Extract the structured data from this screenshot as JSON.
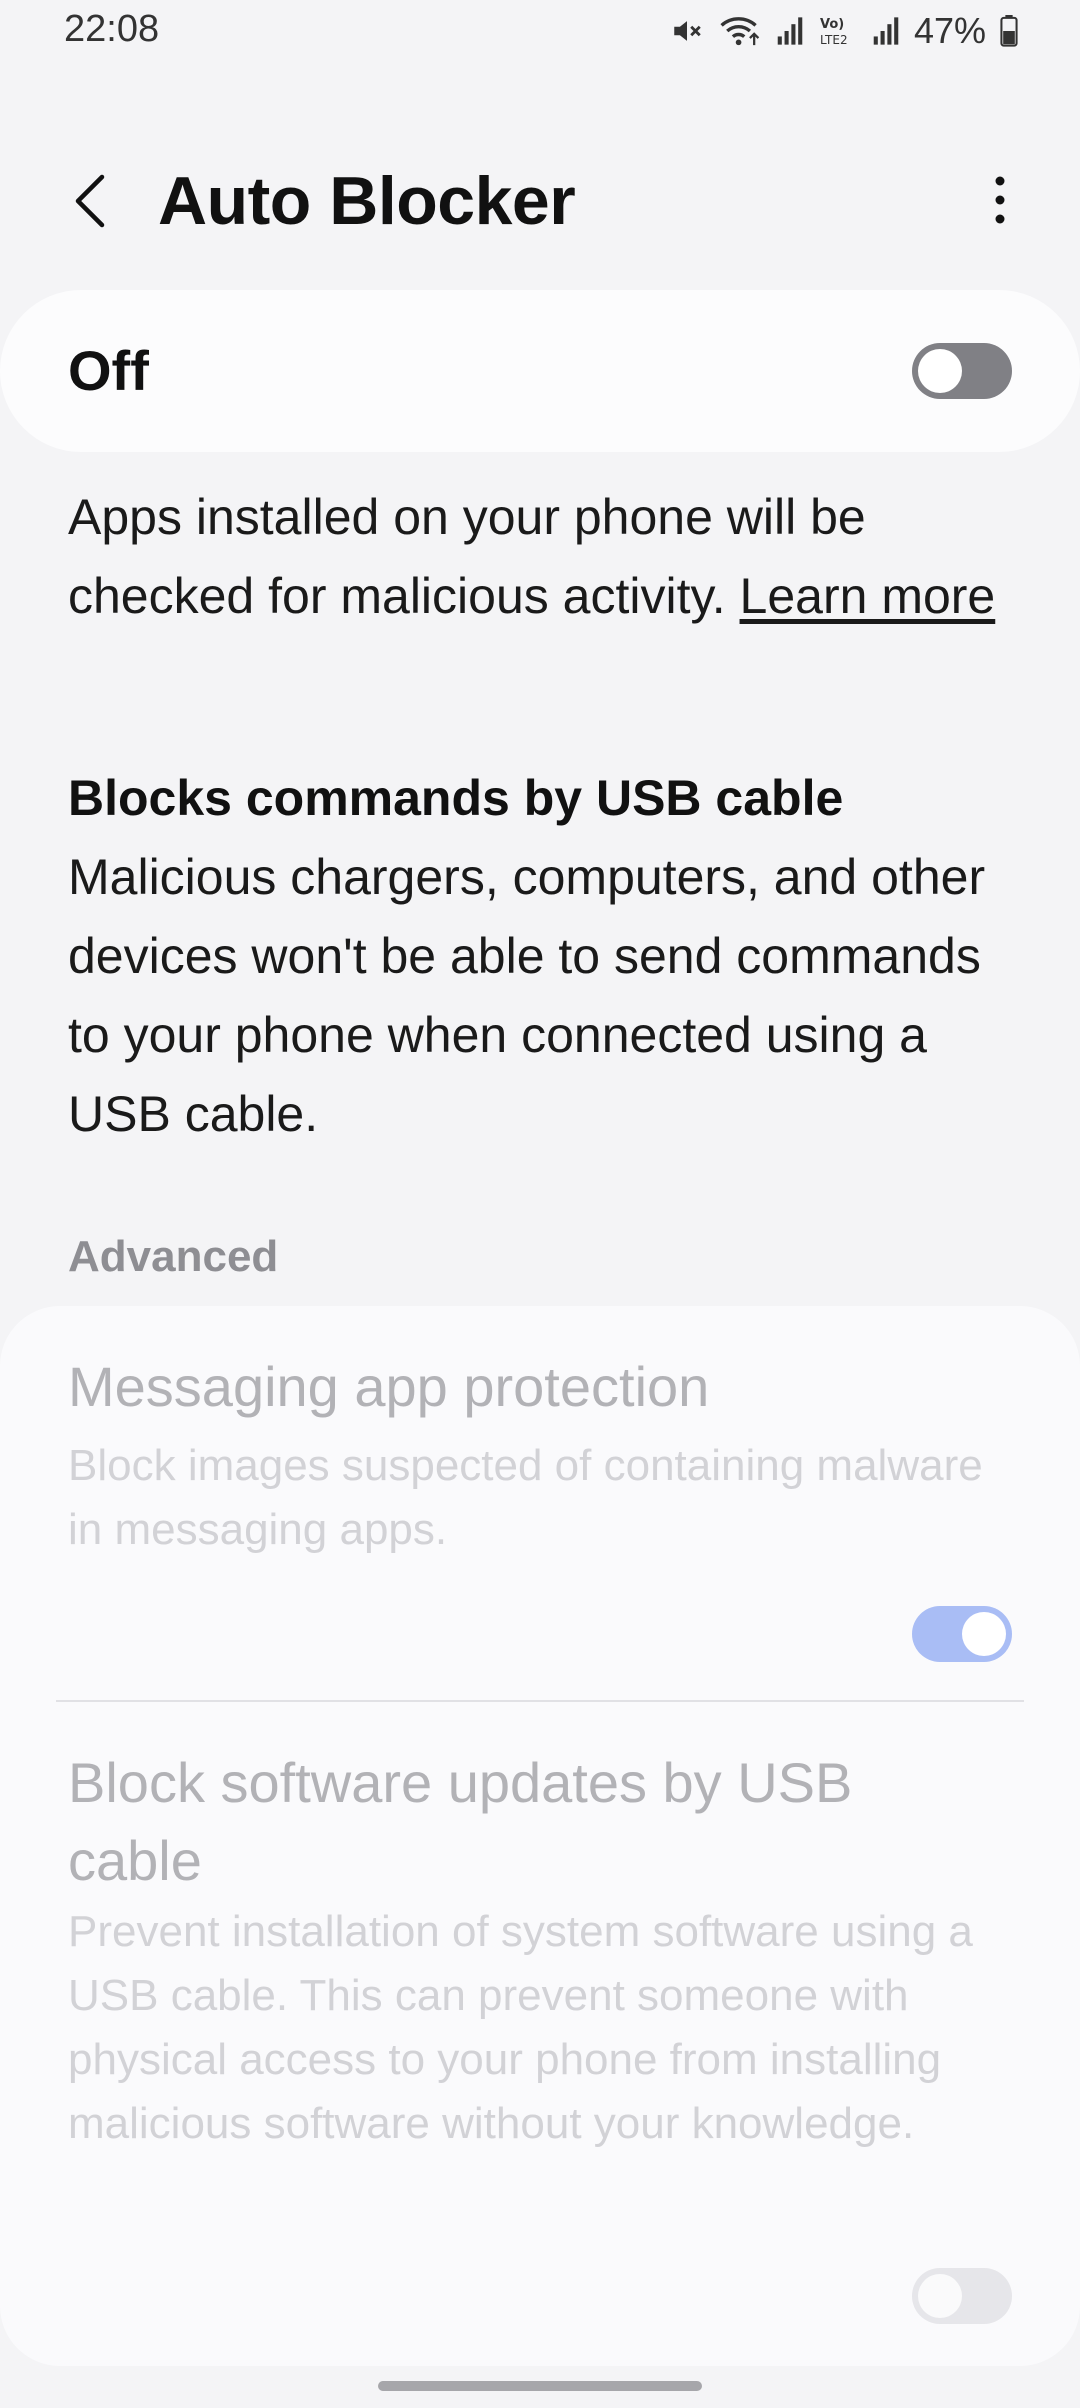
{
  "status_bar": {
    "time": "22:08",
    "battery": "47%",
    "icons": [
      "mute-icon",
      "wifi-icon",
      "signal-icon",
      "volte-icon",
      "signal-icon",
      "battery-icon"
    ],
    "volte_label": "Vo) LTE2"
  },
  "header": {
    "title": "Auto Blocker",
    "back_icon": "back-arrow-icon",
    "more_icon": "more-vert-icon"
  },
  "master_switch": {
    "label": "Off",
    "state": "off"
  },
  "description": {
    "text": "Apps installed on your phone will be checked for malicious activity. ",
    "link": "Learn more"
  },
  "usb_info": {
    "heading": "Blocks commands by USB cable",
    "body": "Malicious chargers, computers, and other devices won't be able to send commands to your phone when connected using a USB cable."
  },
  "advanced": {
    "header": "Advanced",
    "items": [
      {
        "title": "Messaging app protection",
        "description": "Block images suspected of containing malware in messaging apps.",
        "state": "on",
        "enabled": false
      },
      {
        "title": "Block software updates by USB cable",
        "description": "Prevent installation of system software using a USB cable. This can prevent someone with physical access to your phone from installing malicious software without your knowledge.",
        "state": "off",
        "enabled": false
      }
    ]
  },
  "colors": {
    "background": "#f4f4f6",
    "card": "#fcfcfd",
    "toggle_off": "#808085",
    "toggle_on_disabled": "#a9bdf5",
    "disabled_text": "#b2b2b6"
  }
}
